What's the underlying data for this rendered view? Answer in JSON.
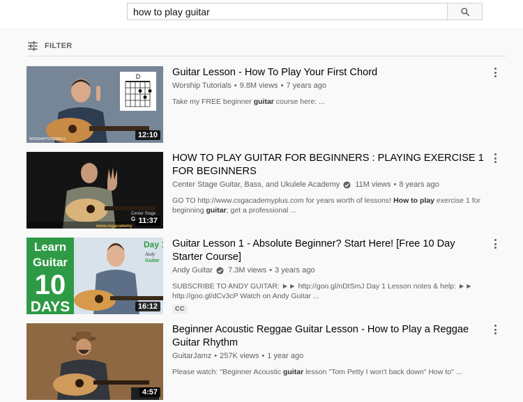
{
  "search": {
    "value": "how to play guitar",
    "button_icon": "search-icon"
  },
  "filter": {
    "label": "FILTER",
    "icon": "filter-sliders-icon"
  },
  "results": [
    {
      "title": "Guitar Lesson - How To Play Your First Chord",
      "channel": "Worship Tutorials",
      "verified": false,
      "views": "9.8M views",
      "age": "7 years ago",
      "desc_parts": [
        {
          "text": "Take my FREE beginner ",
          "bold": false
        },
        {
          "text": "guitar",
          "bold": true
        },
        {
          "text": " course here: ...",
          "bold": false
        }
      ],
      "duration": "12:10",
      "thumb_text": [
        "D",
        "WORSHIPTUTORIALS"
      ],
      "colors": {
        "bg": "#6f7f90",
        "shirt": "#2e3c52",
        "guitar": "#c88a45"
      }
    },
    {
      "title": "HOW TO PLAY GUITAR FOR BEGINNERS : PLAYING EXERCISE 1 FOR BEGINNERS",
      "channel": "Center Stage Guitar, Bass, and Ukulele Academy",
      "verified": true,
      "views": "11M views",
      "age": "8 years ago",
      "desc_parts": [
        {
          "text": "GO TO http://www.csgacademyplus.com for years worth of lessons! ",
          "bold": false
        },
        {
          "text": "How to play",
          "bold": true
        },
        {
          "text": " exercise 1 for beginning ",
          "bold": false
        },
        {
          "text": "guitar",
          "bold": true
        },
        {
          "text": "; get a professional ...",
          "bold": false
        }
      ],
      "duration": "11:37",
      "thumb_text": [
        "Center Stage",
        "GUITAR",
        "www.csgacademy"
      ],
      "colors": {
        "bg": "#141414",
        "shirt": "#7d7f6e",
        "guitar": "#d9b47a"
      }
    },
    {
      "title": "Guitar Lesson 1 - Absolute Beginner? Start Here! [Free 10 Day Starter Course]",
      "channel": "Andy Guitar",
      "verified": true,
      "views": "7.3M views",
      "age": "3 years ago",
      "desc_parts": [
        {
          "text": "SUBSCRIBE TO ANDY GUITAR: ►► http://goo.gl/nDtSmJ Day 1 Lesson notes & help: ►► http://goo.gl/dCv3cP Watch on Andy Guitar ...",
          "bold": false
        }
      ],
      "cc": "CC",
      "duration": "16:12",
      "thumb_text": [
        "Learn",
        "Guitar",
        "10",
        "DAYS",
        "Day 1",
        "Andy",
        "Guitar"
      ],
      "colors": {
        "bg": "#2e9a45",
        "shirt": "#5d6f86",
        "guitar": "#d69a4a"
      }
    },
    {
      "title": "Beginner Acoustic Reggae Guitar Lesson - How to Play a Reggae Guitar Rhythm",
      "channel": "GuitarJamz",
      "verified": false,
      "views": "257K views",
      "age": "1 year ago",
      "desc_parts": [
        {
          "text": "Please watch: \"Beginner Acoustic ",
          "bold": false
        },
        {
          "text": "guitar",
          "bold": true
        },
        {
          "text": " lesson \"Tom Petty I won't back down\" How to\" ...",
          "bold": false
        }
      ],
      "duration": "4:57",
      "thumb_text": [],
      "colors": {
        "bg": "#7a5a3a",
        "shirt": "#33373d",
        "guitar": "#cf9a5b"
      }
    }
  ]
}
